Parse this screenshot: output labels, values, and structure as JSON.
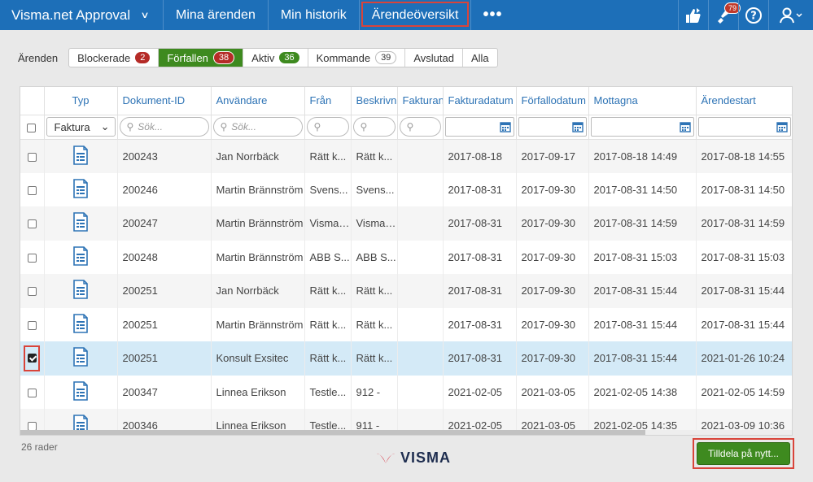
{
  "app": {
    "title": "Visma.net Approval"
  },
  "nav": {
    "items": [
      {
        "label": "Mina ärenden"
      },
      {
        "label": "Min historik"
      },
      {
        "label": "Ärendeöversikt"
      }
    ],
    "more": "•••",
    "notification_count": "79"
  },
  "filter": {
    "label": "Ärenden",
    "segments": [
      {
        "label": "Blockerade",
        "count": "2"
      },
      {
        "label": "Förfallen",
        "count": "38"
      },
      {
        "label": "Aktiv",
        "count": "36"
      },
      {
        "label": "Kommande",
        "count": "39"
      },
      {
        "label": "Avslutad"
      },
      {
        "label": "Alla"
      }
    ]
  },
  "table": {
    "columns": [
      "Typ",
      "Dokument-ID",
      "Användare",
      "Från",
      "Beskrivn",
      "Fakturan",
      "Fakturadatum",
      "Förfallodatum",
      "Mottagna",
      "Ärendestart"
    ],
    "type_filter": "Faktura",
    "search_placeholder": "Sök...",
    "rows": [
      {
        "id": "200243",
        "user": "Jan Norrbäck",
        "from": "Rätt k...",
        "desc": "Rätt k...",
        "inv": "",
        "invdate": "2017-08-18",
        "due": "2017-09-17",
        "recv": "2017-08-18  14:49",
        "start": "2017-08-18  14:55"
      },
      {
        "id": "200246",
        "user": "Martin Brännström",
        "from": "Svens...",
        "desc": "Svens...",
        "inv": "",
        "invdate": "2017-08-31",
        "due": "2017-09-30",
        "recv": "2017-08-31  14:50",
        "start": "2017-08-31  14:50"
      },
      {
        "id": "200247",
        "user": "Martin Brännström",
        "from": "Visma ...",
        "desc": "Visma ...",
        "inv": "",
        "invdate": "2017-08-31",
        "due": "2017-09-30",
        "recv": "2017-08-31  14:59",
        "start": "2017-08-31  14:59"
      },
      {
        "id": "200248",
        "user": "Martin Brännström",
        "from": "ABB S...",
        "desc": "ABB S...",
        "inv": "",
        "invdate": "2017-08-31",
        "due": "2017-09-30",
        "recv": "2017-08-31  15:03",
        "start": "2017-08-31  15:03"
      },
      {
        "id": "200251",
        "user": "Jan Norrbäck",
        "from": "Rätt k...",
        "desc": "Rätt k...",
        "inv": "",
        "invdate": "2017-08-31",
        "due": "2017-09-30",
        "recv": "2017-08-31  15:44",
        "start": "2017-08-31  15:44"
      },
      {
        "id": "200251",
        "user": "Martin Brännström",
        "from": "Rätt k...",
        "desc": "Rätt k...",
        "inv": "",
        "invdate": "2017-08-31",
        "due": "2017-09-30",
        "recv": "2017-08-31  15:44",
        "start": "2017-08-31  15:44"
      },
      {
        "id": "200251",
        "user": "Konsult Exsitec",
        "from": "Rätt k...",
        "desc": "Rätt k...",
        "inv": "",
        "invdate": "2017-08-31",
        "due": "2017-09-30",
        "recv": "2017-08-31  15:44",
        "start": "2021-01-26  10:24"
      },
      {
        "id": "200347",
        "user": "Linnea Erikson",
        "from": "Testle...",
        "desc": "912 -",
        "inv": "",
        "invdate": "2021-02-05",
        "due": "2021-03-05",
        "recv": "2021-02-05  14:38",
        "start": "2021-02-05  14:59"
      },
      {
        "id": "200346",
        "user": "Linnea Erikson",
        "from": "Testle...",
        "desc": "911 -",
        "inv": "",
        "invdate": "2021-02-05",
        "due": "2021-03-05",
        "recv": "2021-02-05  14:35",
        "start": "2021-03-09  10:36"
      }
    ],
    "row_count": "26 rader"
  },
  "footer": {
    "logo_text": "VISMA",
    "assign_button": "Tilldela på nytt..."
  },
  "colors": {
    "topbar": "#1d6fb8",
    "accent_green": "#3e8a1f",
    "badge_red": "#b52b27",
    "highlight": "#d9443a"
  }
}
